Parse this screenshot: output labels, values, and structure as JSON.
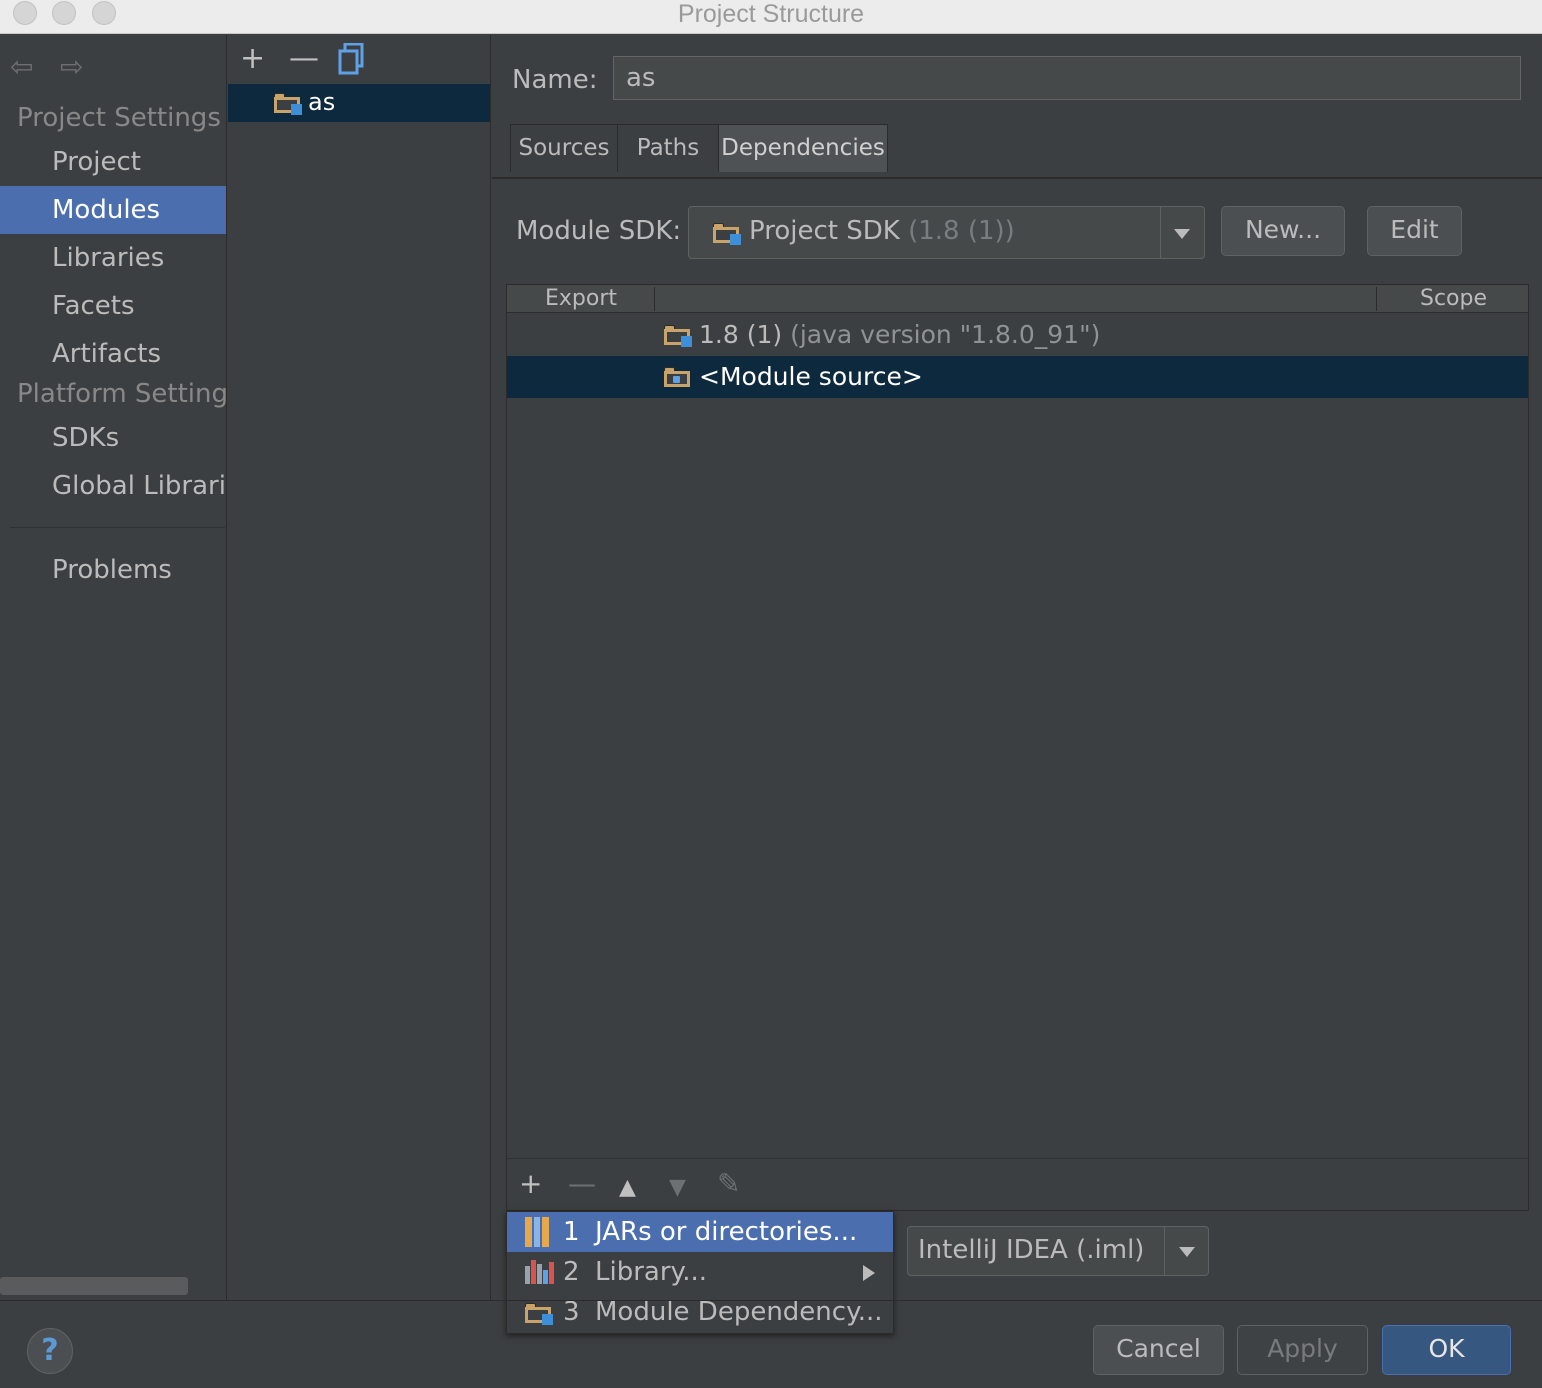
{
  "window": {
    "title": "Project Structure"
  },
  "nav": {
    "back_arrow": "⇦",
    "forward_arrow": "⇨",
    "project_settings_header": "Project Settings",
    "platform_settings_header": "Platform Setting",
    "items": [
      {
        "label": "Project"
      },
      {
        "label": "Modules"
      },
      {
        "label": "Libraries"
      },
      {
        "label": "Facets"
      },
      {
        "label": "Artifacts"
      },
      {
        "label": "SDKs"
      },
      {
        "label": "Global Librarie"
      },
      {
        "label": "Problems"
      }
    ],
    "selected": "Modules"
  },
  "modules_panel": {
    "add_glyph": "+",
    "remove_glyph": "—",
    "module_name": "as"
  },
  "module": {
    "name_label": "Name:",
    "name_value": "as",
    "tabs": [
      {
        "label": "Sources"
      },
      {
        "label": "Paths"
      },
      {
        "label": "Dependencies"
      }
    ],
    "active_tab": "Dependencies",
    "sdk": {
      "label": "Module SDK:",
      "value": "Project SDK",
      "value_detail": "(1.8 (1))",
      "new_button": "New...",
      "edit_button": "Edit"
    }
  },
  "dependencies": {
    "columns": {
      "export": "Export",
      "scope": "Scope"
    },
    "rows": [
      {
        "name": "1.8 (1)",
        "detail": "(java version \"1.8.0_91\")"
      },
      {
        "name": "<Module source>"
      }
    ],
    "toolbar": {
      "add": "+",
      "remove": "—",
      "up": "▲",
      "down": "▼",
      "edit": "✎"
    }
  },
  "add_menu": {
    "items": [
      {
        "number": "1",
        "label": "JARs or directories..."
      },
      {
        "number": "2",
        "label": "Library..."
      },
      {
        "number": "3",
        "label": "Module Dependency..."
      }
    ]
  },
  "storage_format": {
    "value": "IntelliJ IDEA (.iml)"
  },
  "footer": {
    "help": "?",
    "cancel": "Cancel",
    "apply": "Apply",
    "ok": "OK"
  },
  "colors": {
    "background": "#3c3f41",
    "selection_blue": "#4b6eaf",
    "selected_row": "#0d293e",
    "folder_orange": "#c9a46a"
  }
}
